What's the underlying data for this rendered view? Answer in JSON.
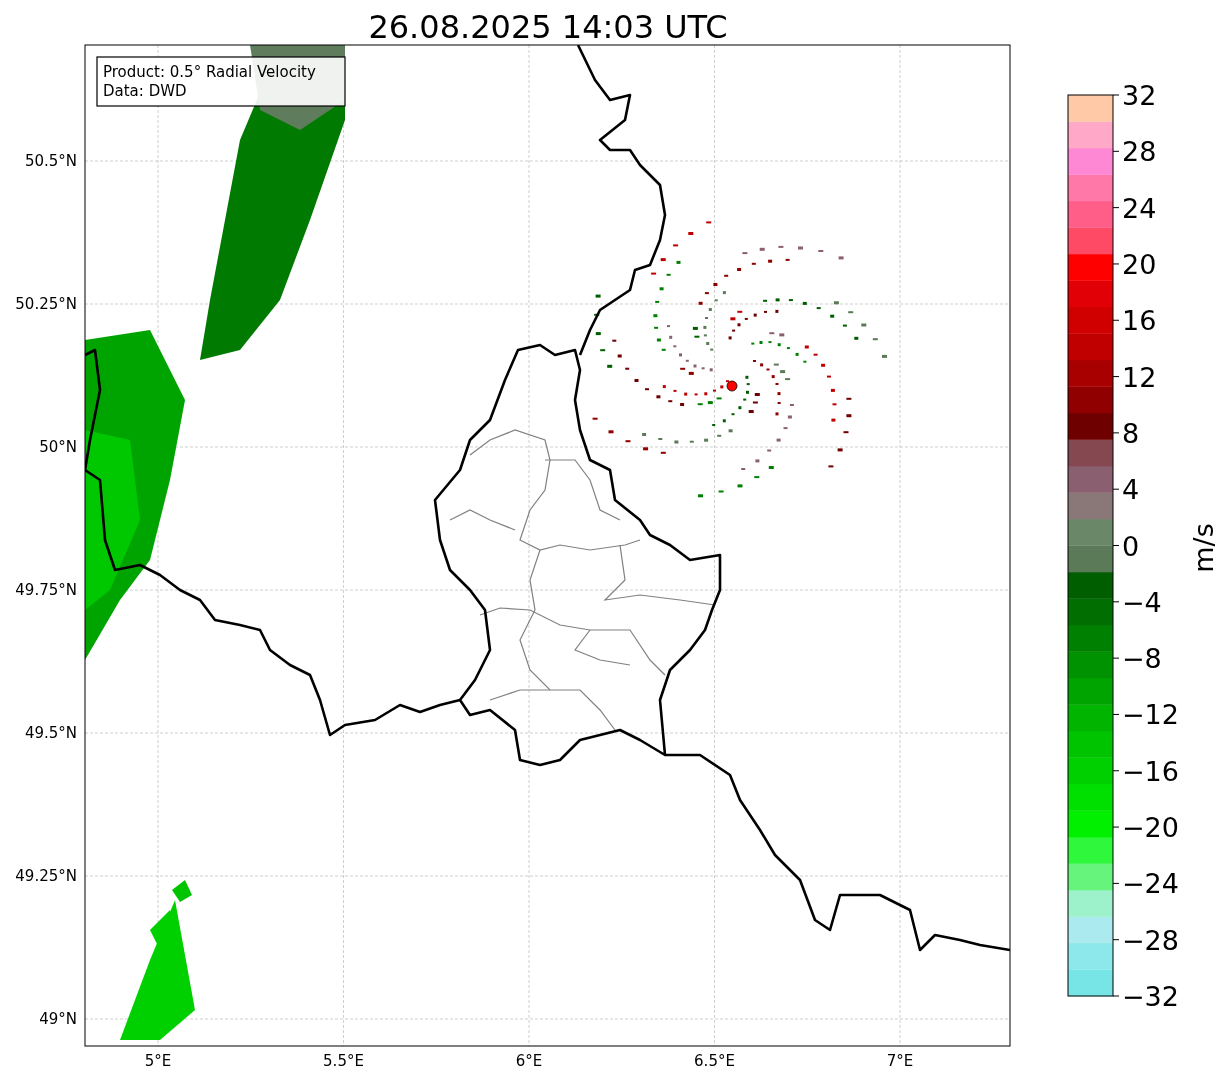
{
  "title": "26.08.2025 14:03 UTC",
  "info_box": [
    "Product: 0.5° Radial Velocity",
    "Data: DWD"
  ],
  "x_ticks": [
    "5°E",
    "5.5°E",
    "6°E",
    "6.5°E",
    "7°E"
  ],
  "y_ticks": [
    "50.5°N",
    "50.25°N",
    "50°N",
    "49.75°N",
    "49.5°N",
    "49.25°N",
    "49°N"
  ],
  "colorbar": {
    "label": "m/s",
    "ticks": [
      "32",
      "28",
      "24",
      "20",
      "16",
      "12",
      "8",
      "4",
      "0",
      "−4",
      "−8",
      "−12",
      "−16",
      "−20",
      "−24",
      "−28",
      "−32"
    ],
    "bands": [
      {
        "color": "#77e4e6"
      },
      {
        "color": "#8ce8ea"
      },
      {
        "color": "#abeaee"
      },
      {
        "color": "#9ef2cb"
      },
      {
        "color": "#66f47c"
      },
      {
        "color": "#2ef73c"
      },
      {
        "color": "#00f000"
      },
      {
        "color": "#00e000"
      },
      {
        "color": "#00d000"
      },
      {
        "color": "#00c400"
      },
      {
        "color": "#00b400"
      },
      {
        "color": "#00a400"
      },
      {
        "color": "#009200"
      },
      {
        "color": "#008000"
      },
      {
        "color": "#006e00"
      },
      {
        "color": "#005e00"
      },
      {
        "color": "#5a7a58"
      },
      {
        "color": "#6a8868"
      },
      {
        "color": "#8a7878"
      },
      {
        "color": "#8a6070"
      },
      {
        "color": "#864850"
      },
      {
        "color": "#6e0000"
      },
      {
        "color": "#900000"
      },
      {
        "color": "#a80000"
      },
      {
        "color": "#c00000"
      },
      {
        "color": "#d00000"
      },
      {
        "color": "#e00006"
      },
      {
        "color": "#ff0000"
      },
      {
        "color": "#ff4a66"
      },
      {
        "color": "#ff5e88"
      },
      {
        "color": "#ff78a8"
      },
      {
        "color": "#ff88d4"
      },
      {
        "color": "#ffa8c8"
      },
      {
        "color": "#ffc9a8"
      }
    ]
  }
}
